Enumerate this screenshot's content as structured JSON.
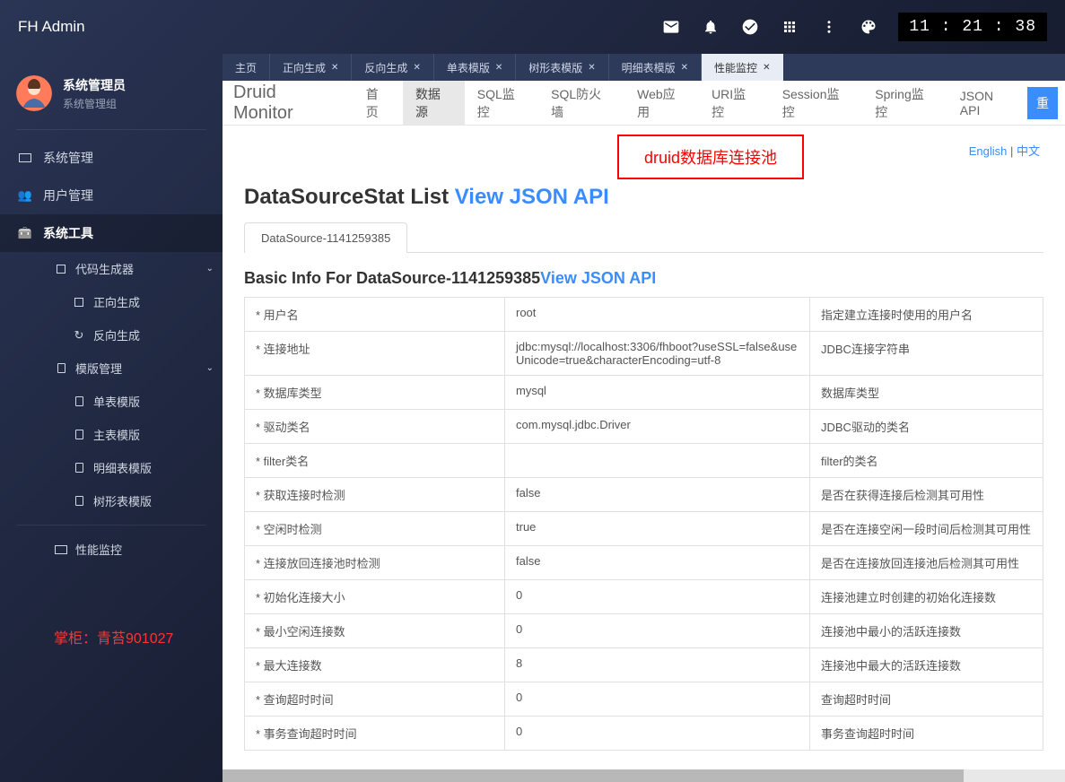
{
  "brand": "FH Admin",
  "clock": "11 : 21 : 38",
  "user": {
    "name": "系统管理员",
    "group": "系统管理组"
  },
  "sidebar": {
    "items": [
      {
        "label": "系统管理"
      },
      {
        "label": "用户管理"
      },
      {
        "label": "系统工具",
        "active": true
      }
    ],
    "sub": {
      "code_gen": "代码生成器",
      "forward": "正向生成",
      "reverse": "反向生成",
      "tpl_mgmt": "模版管理",
      "tpl_single": "单表模版",
      "tpl_master": "主表模版",
      "tpl_detail": "明细表模版",
      "tpl_tree": "树形表模版",
      "perf": "性能监控"
    }
  },
  "watermark": "掌柜：青苔901027",
  "tabs": [
    {
      "label": "主页",
      "closable": false
    },
    {
      "label": "正向生成",
      "closable": true
    },
    {
      "label": "反向生成",
      "closable": true
    },
    {
      "label": "单表模版",
      "closable": true
    },
    {
      "label": "树形表模版",
      "closable": true
    },
    {
      "label": "明细表模版",
      "closable": true
    },
    {
      "label": "性能监控",
      "closable": true,
      "active": true
    }
  ],
  "druid": {
    "brand": "Druid Monitor",
    "nav": [
      "首页",
      "数据源",
      "SQL监控",
      "SQL防火墙",
      "Web应用",
      "URI监控",
      "Session监控",
      "Spring监控",
      "JSON API"
    ],
    "nav_active_index": 1,
    "reset_btn": "重",
    "callout": "druid数据库连接池",
    "lang": {
      "en": "English",
      "sep": " | ",
      "zh": "中文"
    },
    "title_prefix": "DataSourceStat List ",
    "title_link": "View JSON API",
    "ds_tab": "DataSource-1141259385",
    "subtitle_prefix": "Basic Info For DataSource-1141259385",
    "subtitle_link": "View JSON API",
    "rows": [
      {
        "k": "* 用户名",
        "v": "root",
        "d": "指定建立连接时使用的用户名"
      },
      {
        "k": "* 连接地址",
        "v": "jdbc:mysql://localhost:3306/fhboot?useSSL=false&useUnicode=true&characterEncoding=utf-8",
        "d": "JDBC连接字符串"
      },
      {
        "k": "* 数据库类型",
        "v": "mysql",
        "d": "数据库类型"
      },
      {
        "k": "* 驱动类名",
        "v": "com.mysql.jdbc.Driver",
        "d": "JDBC驱动的类名"
      },
      {
        "k": "* filter类名",
        "v": "",
        "d": "filter的类名"
      },
      {
        "k": "* 获取连接时检测",
        "v": "false",
        "d": "是否在获得连接后检测其可用性"
      },
      {
        "k": "* 空闲时检测",
        "v": "true",
        "d": "是否在连接空闲一段时间后检测其可用性"
      },
      {
        "k": "* 连接放回连接池时检测",
        "v": "false",
        "d": "是否在连接放回连接池后检测其可用性"
      },
      {
        "k": "* 初始化连接大小",
        "v": "0",
        "d": "连接池建立时创建的初始化连接数"
      },
      {
        "k": "* 最小空闲连接数",
        "v": "0",
        "d": "连接池中最小的活跃连接数"
      },
      {
        "k": "* 最大连接数",
        "v": "8",
        "d": "连接池中最大的活跃连接数"
      },
      {
        "k": "* 查询超时时间",
        "v": "0",
        "d": "查询超时时间"
      },
      {
        "k": "* 事务查询超时时间",
        "v": "0",
        "d": "事务查询超时时间"
      }
    ]
  }
}
